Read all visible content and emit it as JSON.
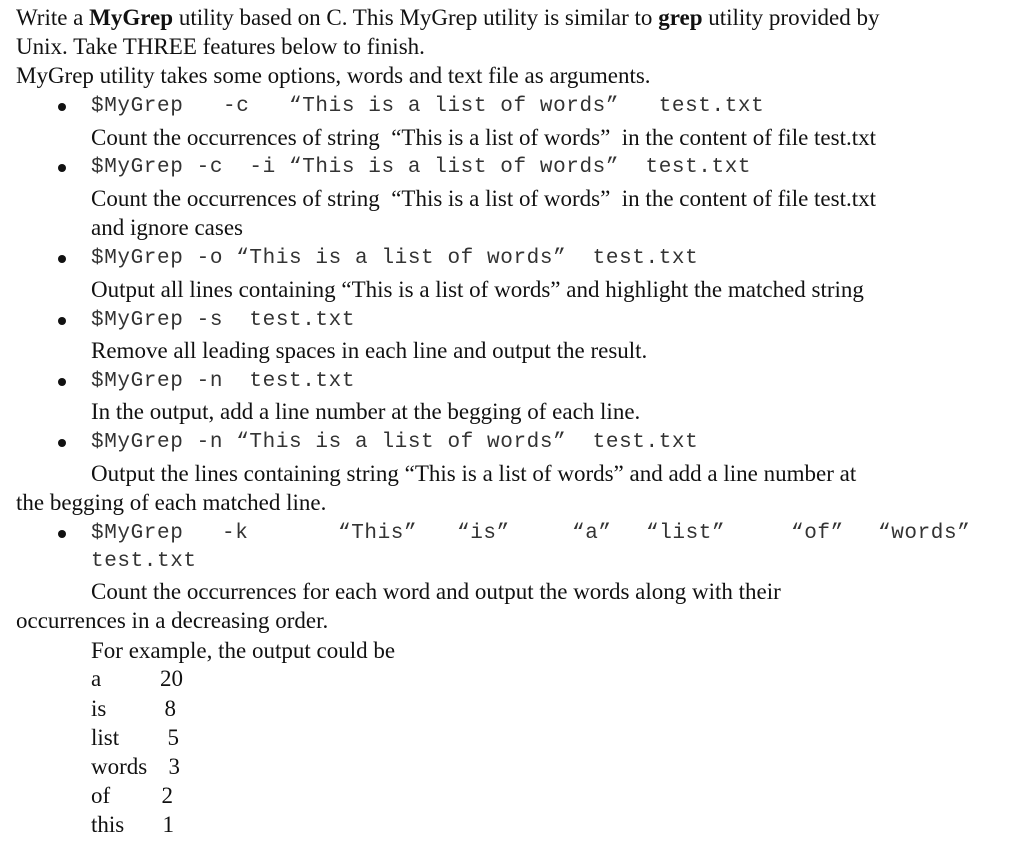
{
  "intro": {
    "line1_before": "Write a ",
    "line1_bold1": "MyGrep",
    "line1_middle": " utility based on C. This MyGrep utility is similar to ",
    "line1_bold2": "grep",
    "line1_after": " utility provided by",
    "line2": "Unix. Take THREE features below to finish.",
    "line3": "MyGrep utility takes some options, words and text file as arguments."
  },
  "features": [
    {
      "command": "$MyGrep   -c   “This is a list of words”   test.txt",
      "description": [
        "Count the occurrences of string  “This is a list of words”  in the content of file test.txt"
      ]
    },
    {
      "command": "$MyGrep -c  -i “This is a list of words”  test.txt",
      "description": [
        "Count the occurrences of string  “This is a list of words”  in the content of file test.txt",
        "and ignore cases"
      ]
    },
    {
      "command": "$MyGrep -o “This is a list of words”  test.txt",
      "description": [
        "Output all lines containing “This is a list of words” and highlight the matched string"
      ]
    },
    {
      "command": "$MyGrep -s  test.txt",
      "description": [
        "Remove all leading spaces in each line and output the result."
      ]
    },
    {
      "command": "$MyGrep -n  test.txt",
      "description": [
        "In the output, add a line number at the begging of each line."
      ]
    },
    {
      "command": "$MyGrep -n “This is a list of words”  test.txt",
      "description": [
        "Output the lines containing string “This is a list of words” and add a line number at",
        "the begging of each matched line."
      ]
    },
    {
      "command_parts": [
        "$MyGrep",
        "-k",
        "“This”",
        "“is”",
        "“a”",
        "“list”",
        "“of”",
        "“words”"
      ],
      "command_line2": "test.txt",
      "description": [
        "Count the occurrences for each word and output the words along with their",
        "occurrences in a decreasing order."
      ]
    }
  ],
  "example": {
    "intro": "For example, the output could be",
    "rows": [
      {
        "word": "a",
        "count": "20"
      },
      {
        "word": "is",
        "count": "8"
      },
      {
        "word": "list",
        "count": "5"
      },
      {
        "word": "words",
        "count": "3"
      },
      {
        "word": "of",
        "count": "2"
      },
      {
        "word": "this",
        "count": "1"
      }
    ]
  }
}
